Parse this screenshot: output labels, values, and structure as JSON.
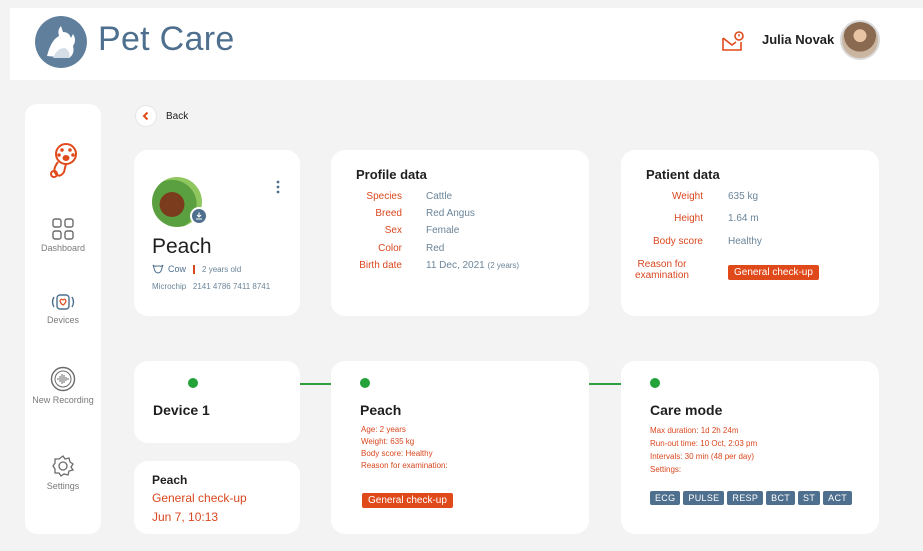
{
  "header": {
    "brand": "Pet Care",
    "user_name": "Julia Novak",
    "notification_icon": "mail-notification-icon",
    "logo_icon": "pet-logo-icon"
  },
  "sidebar": {
    "items": [
      {
        "label": "",
        "icon": "stethoscope-paw-icon"
      },
      {
        "label": "Dashboard",
        "icon": "dashboard-icon"
      },
      {
        "label": "Devices",
        "icon": "devices-icon"
      },
      {
        "label": "New Recording",
        "icon": "recording-icon"
      },
      {
        "label": "Settings",
        "icon": "gear-icon"
      }
    ]
  },
  "nav": {
    "back_label": "Back"
  },
  "patient_card": {
    "name": "Peach",
    "species_label": "Cow",
    "age_label": "2 years old",
    "microchip_label": "Microchip",
    "microchip_value": "2141 4786 7411 8741"
  },
  "profile_data": {
    "title": "Profile data",
    "rows": [
      {
        "key": "Species",
        "value": "Cattle"
      },
      {
        "key": "Breed",
        "value": "Red Angus"
      },
      {
        "key": "Sex",
        "value": "Female"
      },
      {
        "key": "Color",
        "value": "Red"
      },
      {
        "key": "Birth date",
        "value": "11 Dec, 2021",
        "extra": "(2 years)"
      }
    ]
  },
  "patient_data": {
    "title": "Patient data",
    "rows": [
      {
        "key": "Weight",
        "value": "635 kg"
      },
      {
        "key": "Height",
        "value": "1.64 m"
      },
      {
        "key": "Body score",
        "value": "Healthy"
      }
    ],
    "reason_key_line1": "Reason for",
    "reason_key_line2": "examination",
    "reason_value": "General check-up"
  },
  "device_card": {
    "title": "Device 1"
  },
  "recording_card": {
    "name": "Peach",
    "reason": "General check-up",
    "date": "Jun 7, 10:13"
  },
  "peach_card": {
    "title": "Peach",
    "age": "Age:  2 years",
    "weight": "Weight:  635 kg",
    "body_score": "Body score:  Healthy",
    "reason_label": "Reason for examination:",
    "reason_value": "General check-up"
  },
  "care_mode": {
    "title": "Care mode",
    "max_duration": "Max duration:  1d 2h 24m",
    "run_out": "Run-out time:  10 Oct, 2:03 pm",
    "intervals": "Intervals:  30 min (48 per day)",
    "settings_label": "Settings:",
    "tags": [
      "ECG",
      "PULSE",
      "RESP",
      "BCT",
      "ST",
      "ACT"
    ]
  },
  "colors": {
    "accent": "#e04a1b",
    "brand": "#4e6f8e",
    "timeline": "#23a23a"
  }
}
